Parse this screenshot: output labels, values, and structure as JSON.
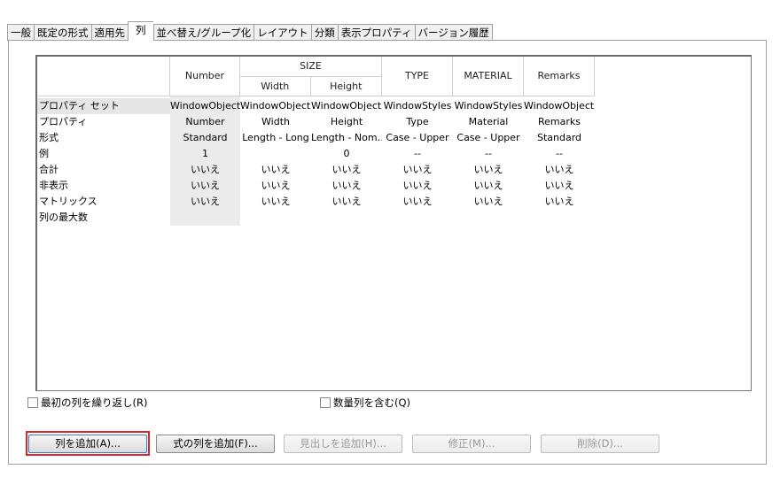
{
  "tabs": [
    "一般",
    "既定の形式",
    "適用先",
    "列",
    "並べ替え/グループ化",
    "レイアウト",
    "分類",
    "表示プロパティ",
    "バージョン履歴"
  ],
  "active_tab": "列",
  "grid": {
    "headers": {
      "number": "Number",
      "size_group": "SIZE",
      "width": "Width",
      "height": "Height",
      "type": "TYPE",
      "material": "MATERIAL",
      "remarks": "Remarks"
    },
    "row_labels": [
      "プロパティ セット",
      "プロパティ",
      "形式",
      "例",
      "合計",
      "非表示",
      "マトリックス",
      "列の最大数"
    ],
    "columns": [
      [
        "WindowObjects",
        "Number",
        "Standard",
        "1",
        "いいえ",
        "いいえ",
        "いいえ"
      ],
      [
        "WindowObjects",
        "Width",
        "Length - Long",
        "",
        "いいえ",
        "いいえ",
        "いいえ"
      ],
      [
        "WindowObjects",
        "Height",
        "Length - Nom…",
        "0",
        "いいえ",
        "いいえ",
        "いいえ"
      ],
      [
        "WindowStyles",
        "Type",
        "Case - Upper",
        "--",
        "いいえ",
        "いいえ",
        "いいえ"
      ],
      [
        "WindowStyles",
        "Material",
        "Case - Upper",
        "--",
        "いいえ",
        "いいえ",
        "いいえ"
      ],
      [
        "WindowObjects",
        "Remarks",
        "Standard",
        "--",
        "いいえ",
        "いいえ",
        "いいえ"
      ]
    ]
  },
  "checkboxes": {
    "repeat_first_column": "最初の列を繰り返し(R)",
    "include_quantity_column": "数量列を含む(Q)"
  },
  "buttons": {
    "add_column": "列を追加(A)...",
    "add_formula_column": "式の列を追加(F)...",
    "add_header": "見出しを追加(H)...",
    "modify": "修正(M)...",
    "delete": "削除(D)..."
  },
  "colors": {
    "highlight": "#d9262c",
    "focus_border": "#3c7fb1"
  }
}
